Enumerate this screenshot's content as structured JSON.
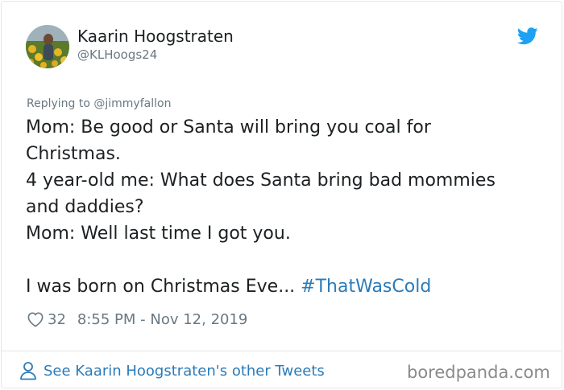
{
  "author": {
    "display_name": "Kaarin Hoogstraten",
    "handle": "@KLHoogs24"
  },
  "reply_context": "Replying to @jimmyfallon",
  "tweet": {
    "lines": [
      "Mom: Be good or Santa will bring you coal for",
      "Christmas.",
      "4 year-old me: What does Santa bring bad mommies",
      "and daddies?",
      "Mom: Well last time I got you."
    ],
    "closing_text": "I was born on Christmas Eve... ",
    "hashtag": "#ThatWasCold"
  },
  "meta": {
    "like_count": "32",
    "timestamp": "8:55 PM - Nov 12, 2019"
  },
  "footer": {
    "see_more_label": "See Kaarin Hoogstraten's other Tweets"
  },
  "watermark": "boredpanda.com",
  "icons": {
    "brand": "twitter-bird-icon",
    "like": "heart-icon",
    "profile": "person-icon"
  },
  "colors": {
    "link": "#2b7bb9",
    "secondary_text": "#697882",
    "border": "#e1e8ed",
    "twitter_blue": "#1da1f2"
  }
}
